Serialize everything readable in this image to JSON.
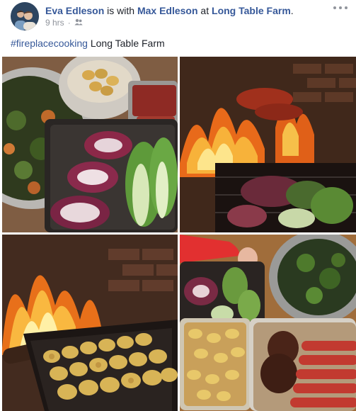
{
  "post": {
    "author": "Eva Edleson",
    "connector": " is with ",
    "tagged_person": "Max Edleson",
    "location_prefix": " at ",
    "location": "Long Table Farm",
    "location_suffix": ".",
    "time": "9 hrs",
    "separator": "·",
    "privacy_icon": "friends-icon",
    "more_icon": "more-options-icon",
    "caption": {
      "hashtag": "#fireplacecooking",
      "text": " Long Table Farm"
    }
  },
  "photos": [
    {
      "name": "photo-vegetables-and-meat-prep"
    },
    {
      "name": "photo-fireplace-grilling-vegetables"
    },
    {
      "name": "photo-fire-roasting-potatoes"
    },
    {
      "name": "photo-cooked-dishes-on-table"
    }
  ],
  "colors": {
    "link": "#365899",
    "meta": "#90949c",
    "text": "#1d2129"
  }
}
